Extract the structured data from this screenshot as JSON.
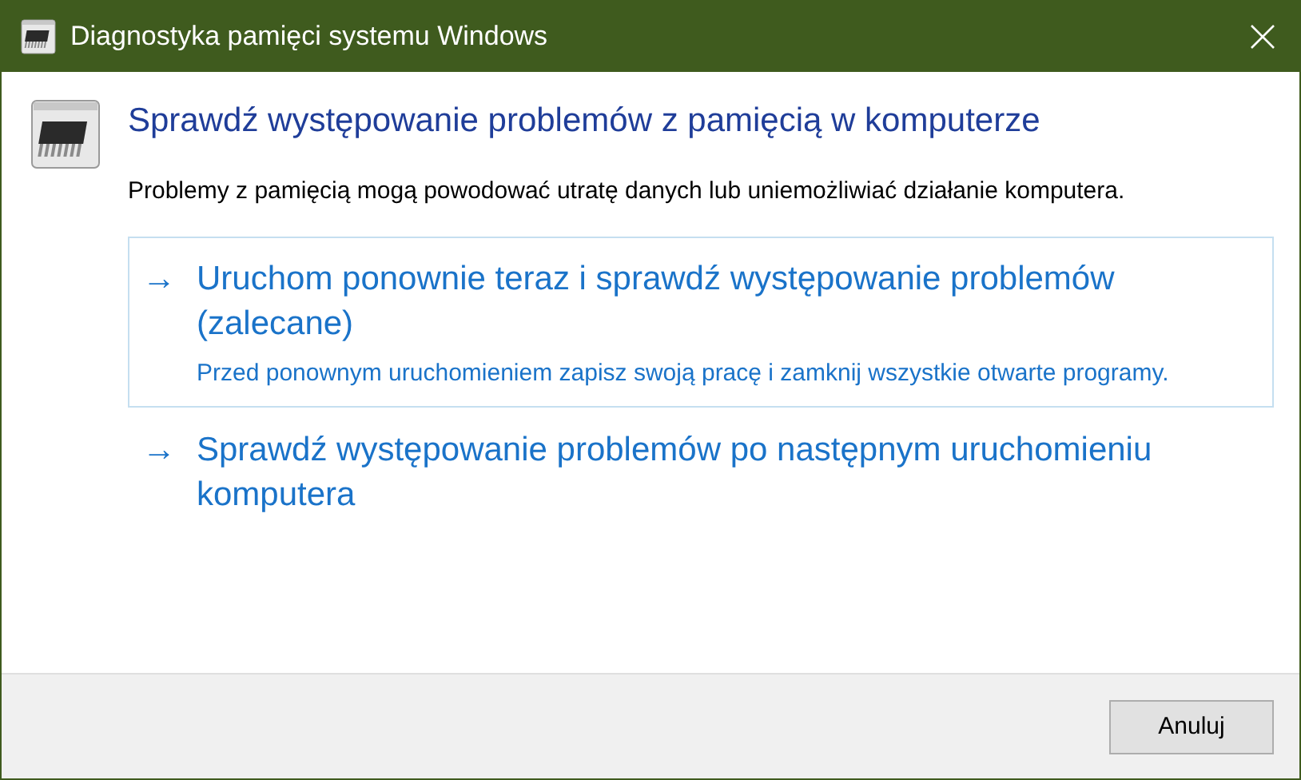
{
  "window": {
    "title": "Diagnostyka pamięci systemu Windows"
  },
  "heading": "Sprawdź występowanie problemów z pamięcią w komputerze",
  "description": "Problemy z pamięcią mogą powodować utratę danych lub uniemożliwiać działanie komputera.",
  "options": [
    {
      "arrow": "→",
      "title": "Uruchom ponownie teraz i sprawdź występowanie problemów (zalecane)",
      "note": "Przed ponownym uruchomieniem zapisz swoją pracę i zamknij wszystkie otwarte programy.",
      "focused": true
    },
    {
      "arrow": "→",
      "title": "Sprawdź występowanie problemów po następnym uruchomieniu komputera",
      "focused": false
    }
  ],
  "buttons": [
    "Anuluj"
  ]
}
